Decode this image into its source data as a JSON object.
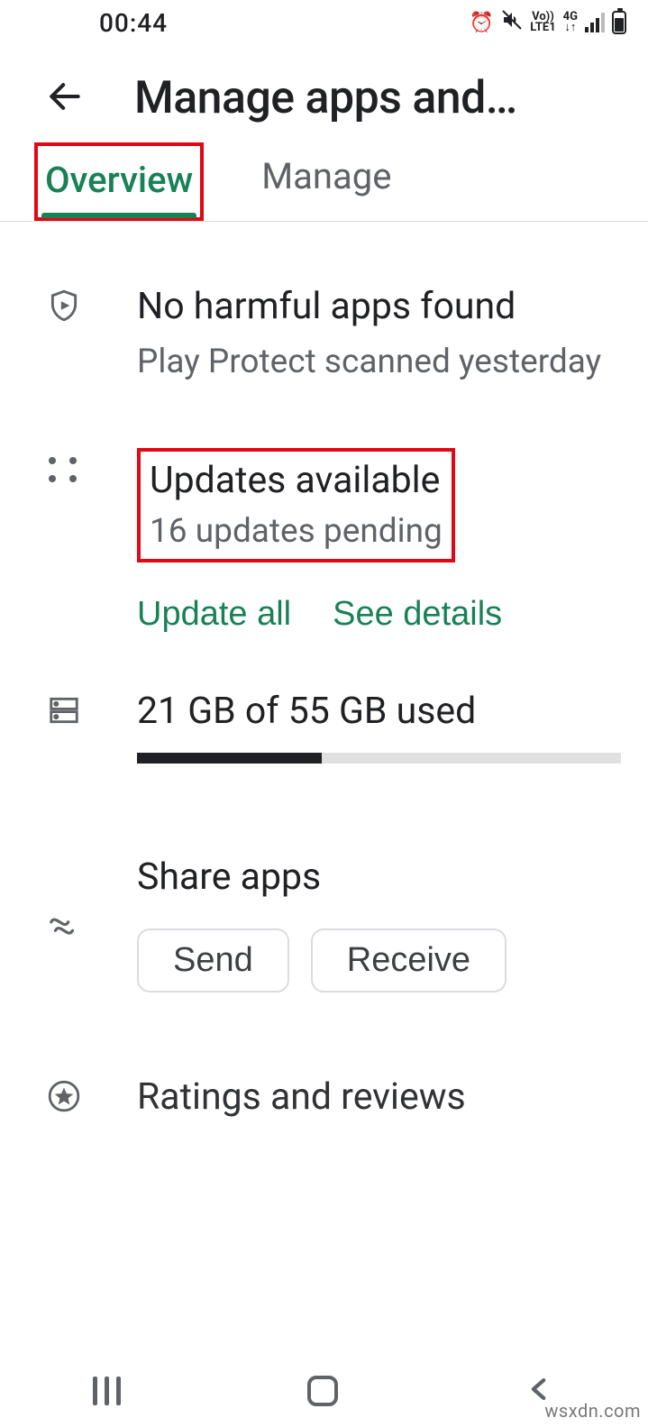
{
  "status": {
    "time": "00:44",
    "volte": "Vo))",
    "lte": "LTE1",
    "net": "4G"
  },
  "header": {
    "title": "Manage apps and…"
  },
  "tabs": {
    "overview": "Overview",
    "manage": "Manage"
  },
  "protect": {
    "title": "No harmful apps found",
    "subtitle": "Play Protect scanned yesterday"
  },
  "updates": {
    "title": "Updates available",
    "subtitle": "16 updates pending",
    "update_all": "Update all",
    "see_details": "See details"
  },
  "storage": {
    "text": "21 GB of 55 GB used",
    "used": 21,
    "total": 55
  },
  "share": {
    "title": "Share apps",
    "send": "Send",
    "receive": "Receive"
  },
  "ratings": {
    "title": "Ratings and reviews"
  },
  "watermark": "wsxdn.com"
}
